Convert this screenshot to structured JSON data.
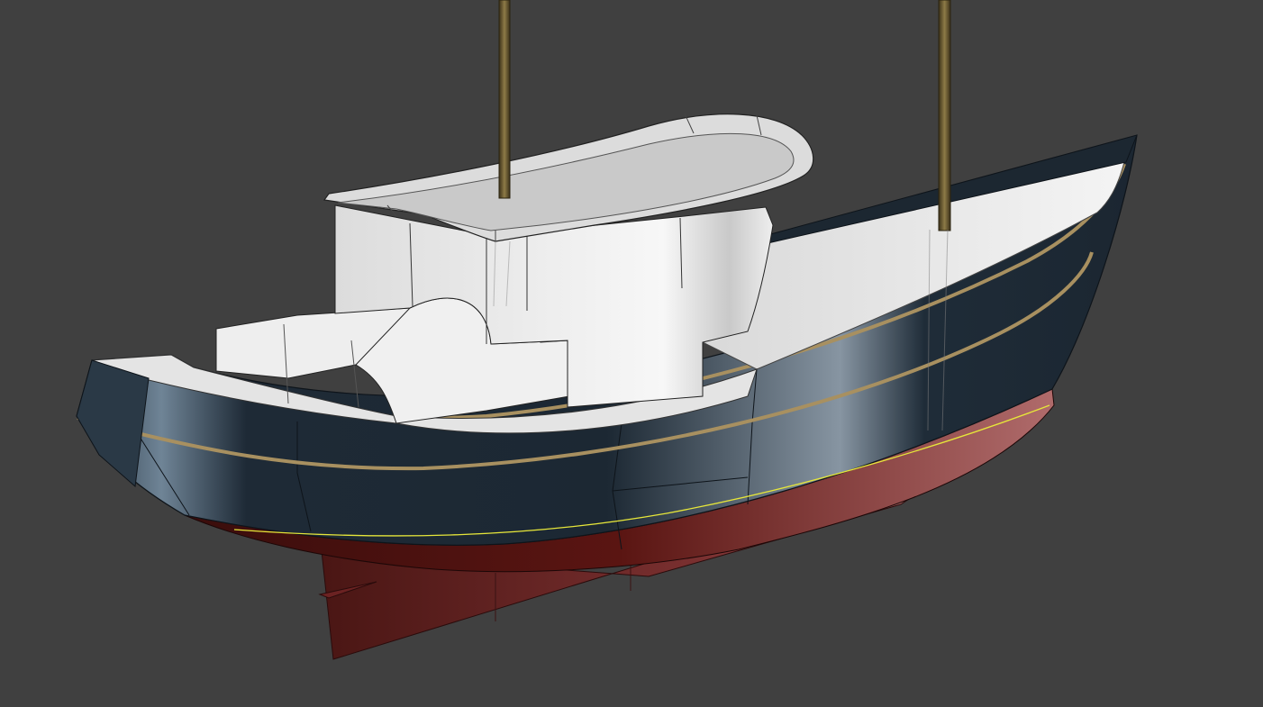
{
  "scene": {
    "background_color": "#404040",
    "hull_topside_color": "#1e2a36",
    "hull_bottom_color": "#5a1512",
    "keel_color": "#7a2a2a",
    "deck_color": "#e8e8e8",
    "cabin_color": "#f2f2f2",
    "rubrail_color": "#a08a5a",
    "waterline_color": "#e6e63a",
    "mast_color": "#6b5a2e"
  }
}
